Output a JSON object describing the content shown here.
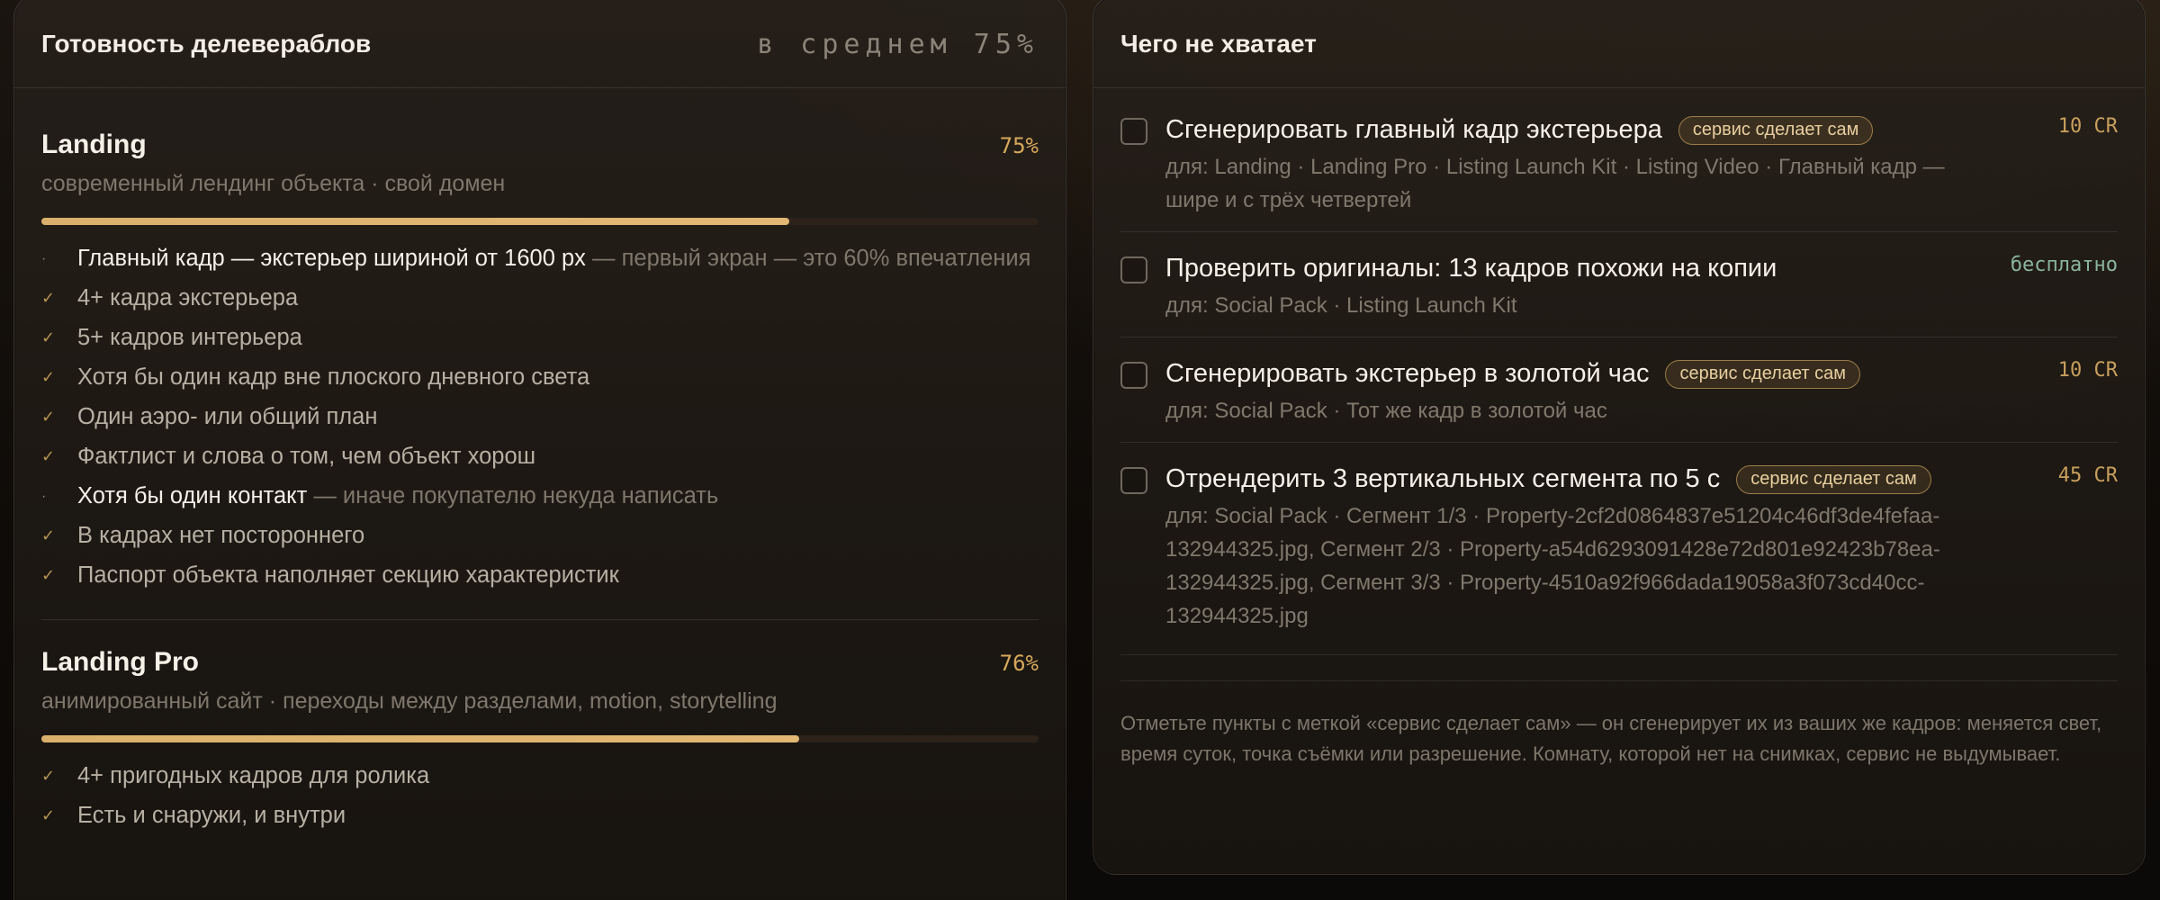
{
  "left": {
    "title": "Готовность делевераблов",
    "average": "в среднем 75%",
    "deliverables": [
      {
        "name": "Landing",
        "percent_label": "75%",
        "progress": 0.75,
        "subtitle": "современный лендинг объекта · свой домен",
        "checks": [
          {
            "status": "pending",
            "text": "Главный кадр — экстерьер шириной от 1600 px",
            "hint": " — первый экран — это 60% впечатления"
          },
          {
            "status": "done",
            "text": "4+ кадра экстерьера",
            "hint": ""
          },
          {
            "status": "done",
            "text": "5+ кадров интерьера",
            "hint": ""
          },
          {
            "status": "done",
            "text": "Хотя бы один кадр вне плоского дневного света",
            "hint": ""
          },
          {
            "status": "done",
            "text": "Один аэро- или общий план",
            "hint": ""
          },
          {
            "status": "done",
            "text": "Фактлист и слова о том, чем объект хорош",
            "hint": ""
          },
          {
            "status": "pending",
            "text": "Хотя бы один контакт",
            "hint": " — иначе покупателю некуда написать"
          },
          {
            "status": "done",
            "text": "В кадрах нет постороннего",
            "hint": ""
          },
          {
            "status": "done",
            "text": "Паспорт объекта наполняет секцию характеристик",
            "hint": ""
          }
        ]
      },
      {
        "name": "Landing Pro",
        "percent_label": "76%",
        "progress": 0.76,
        "subtitle": "анимированный сайт · переходы между разделами, motion, storytelling",
        "checks": [
          {
            "status": "done",
            "text": "4+ пригодных кадров для ролика",
            "hint": ""
          },
          {
            "status": "done",
            "text": "Есть и снаружи, и внутри",
            "hint": ""
          }
        ]
      }
    ]
  },
  "right": {
    "title": "Чего не хватает",
    "tasks": [
      {
        "title": "Сгенерировать главный кадр экстерьера",
        "tag": "сервис сделает сам",
        "cost": "10 CR",
        "free": false,
        "sub": "для: Landing · Landing Pro · Listing Launch Kit · Listing Video · Главный кадр — шире и с трёх четвертей"
      },
      {
        "title": "Проверить оригиналы: 13 кадров похожи на копии",
        "tag": "",
        "cost": "бесплатно",
        "free": true,
        "sub": "для: Social Pack · Listing Launch Kit"
      },
      {
        "title": "Сгенерировать экстерьер в золотой час",
        "tag": "сервис сделает сам",
        "cost": "10 CR",
        "free": false,
        "sub": "для: Social Pack · Тот же кадр в золотой час"
      },
      {
        "title": "Отрендерить 3 вертикальных сегмента по 5 с",
        "tag": "сервис сделает сам",
        "cost": "45 CR",
        "free": false,
        "sub": "для: Social Pack · Сегмент 1/3 · Property-2cf2d0864837e51204c46df3de4fefaa-132944325.jpg, Сегмент 2/3 · Property-a54d6293091428e72d801e92423b78ea-132944325.jpg, Сегмент 3/3 · Property-4510a92f966dada19058a3f073cd40cc-132944325.jpg"
      }
    ],
    "footnote": "Отметьте пункты с меткой «сервис сделает сам» — он сгенерирует их из ваших же кадров: меняется свет, время суток, точка съёмки или разрешение. Комнату, которой нет на снимках, сервис не выдумывает."
  },
  "colors": {
    "accent": "#d7a95b",
    "free": "#8bb59d",
    "muted": "#7e776c"
  }
}
